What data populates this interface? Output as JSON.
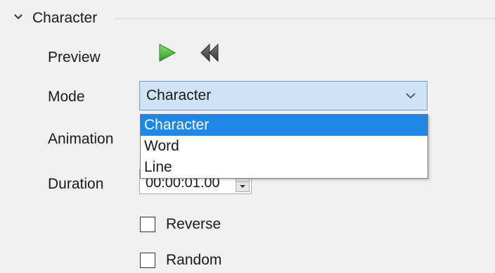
{
  "section": {
    "title": "Character",
    "chevron_icon": "chevron-down-icon"
  },
  "preview": {
    "label": "Preview",
    "play_icon": "play-icon",
    "rewind_icon": "rewind-icon",
    "play_color": "#3aa335"
  },
  "mode": {
    "label": "Mode",
    "selected": "Character",
    "options": [
      "Character",
      "Word",
      "Line"
    ]
  },
  "animation": {
    "label": "Animation"
  },
  "duration": {
    "label": "Duration",
    "value": "00:00:01.00"
  },
  "reverse": {
    "label": "Reverse",
    "checked": false
  },
  "random": {
    "label": "Random",
    "checked": false
  },
  "colors": {
    "accent": "#1e86e6",
    "combo_background": "#cfe3f6",
    "combo_border": "#6e9fd3",
    "panel_background": "#f0f0f0"
  }
}
